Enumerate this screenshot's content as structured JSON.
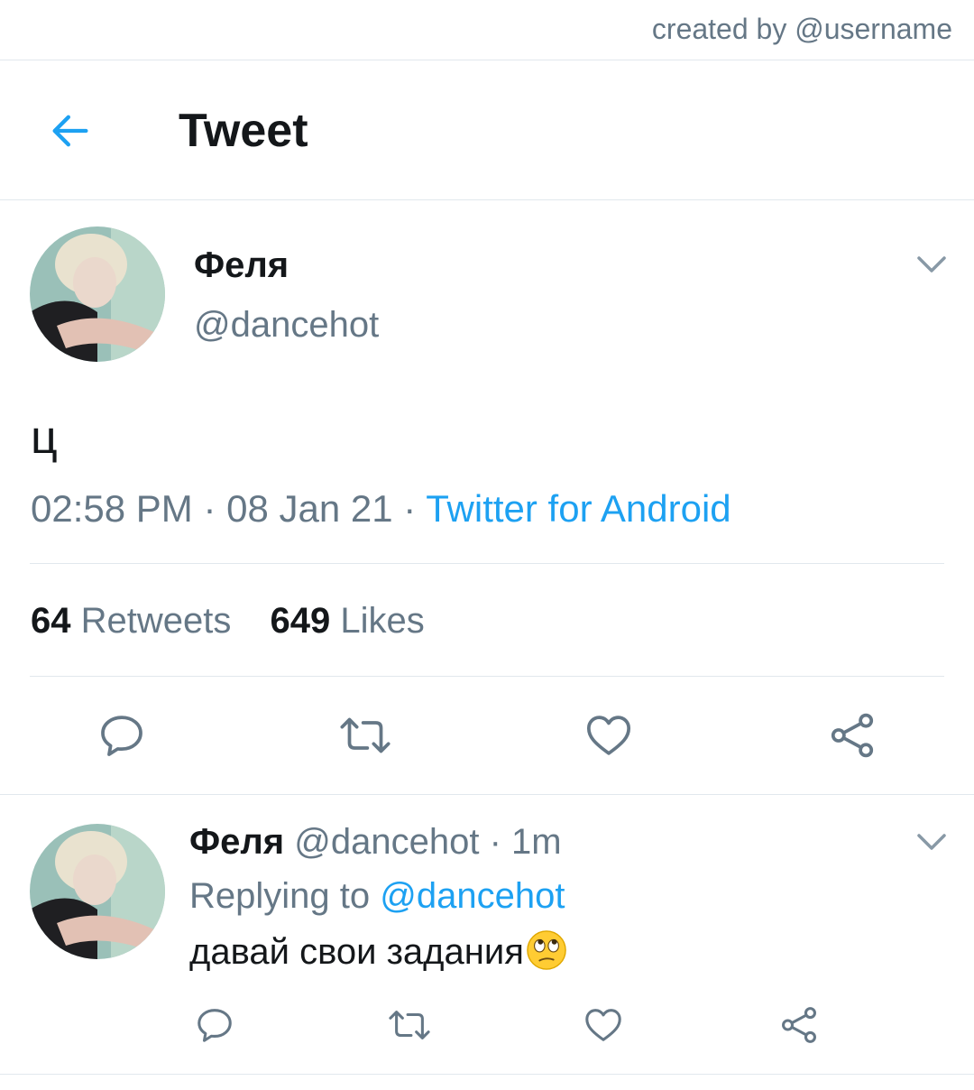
{
  "watermark": "created by @username",
  "header": {
    "title": "Tweet"
  },
  "tweet": {
    "name": "Феля",
    "handle": "@dancehot",
    "text": "ц",
    "time": "02:58 PM",
    "sep1": " · ",
    "date": "08 Jan 21",
    "sep2": " · ",
    "source": "Twitter for Android",
    "retweets_count": "64",
    "retweets_label": "Retweets",
    "likes_count": "649",
    "likes_label": "Likes"
  },
  "reply": {
    "name": "Феля",
    "handle": "@dancehot",
    "sep": " · ",
    "time": "1m",
    "replying_prefix": "Replying to",
    "replying_to": "@dancehot",
    "text": "давай свои задания"
  },
  "icons": {
    "back": "arrow-left-icon",
    "more": "chevron-down-icon",
    "reply": "comment-icon",
    "retweet": "retweet-icon",
    "like": "heart-icon",
    "share": "share-icon",
    "emoji": "face-with-rolling-eyes-emoji"
  },
  "colors": {
    "accent": "#1da1f2",
    "secondary_text": "#657786",
    "icon": "#657786",
    "divider": "#e1e8ed"
  }
}
